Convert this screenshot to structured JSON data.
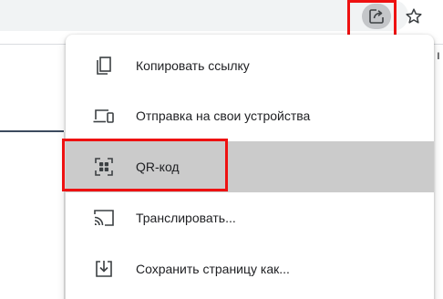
{
  "toolbar": {
    "share_icon": "share-icon",
    "bookmark_icon": "star-icon",
    "right_clipped_text": "ı"
  },
  "menu": {
    "items": [
      {
        "label": "Копировать ссылку",
        "icon": "copy-icon"
      },
      {
        "label": "Отправка на свои устройства",
        "icon": "devices-icon"
      },
      {
        "label": "QR-код",
        "icon": "qr-code-icon",
        "highlighted": true
      },
      {
        "label": "Транслировать...",
        "icon": "cast-icon"
      },
      {
        "label": "Сохранить страницу как...",
        "icon": "download-icon"
      }
    ]
  },
  "colors": {
    "highlight_box": "#ee1111",
    "active_row": "#cbcbcb",
    "share_button": "#c4c6c9",
    "icon": "#3c4043"
  }
}
